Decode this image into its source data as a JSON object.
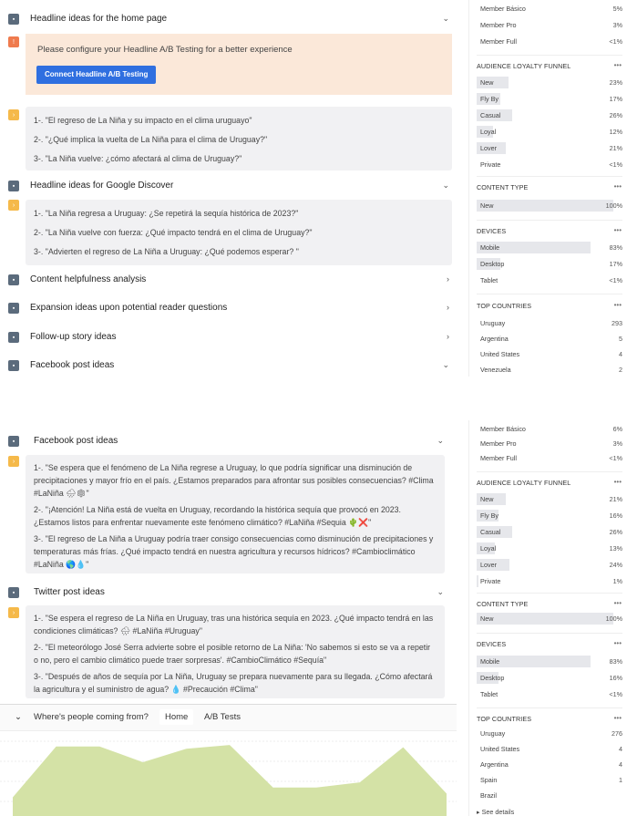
{
  "top": {
    "headline_home": {
      "title": "Headline ideas for the home page",
      "chevron": "⌄"
    },
    "warning": {
      "text": "Please configure your Headline A/B Testing for a better experience",
      "button": "Connect Headline A/B Testing"
    },
    "home_ideas": [
      "1-. \"El regreso de La Niña y su impacto en el clima uruguayo\"",
      "2-. \"¿Qué implica la vuelta de La Niña para el clima de Uruguay?\"",
      "3-. \"La Niña vuelve: ¿cómo afectará al clima de Uruguay?\""
    ],
    "discover": {
      "title": "Headline ideas for Google Discover",
      "chevron": "⌄"
    },
    "discover_ideas": [
      "1-. \"La Niña regresa a Uruguay: ¿Se repetirá la sequía histórica de 2023?\"",
      "2-. \"La Niña vuelve con fuerza: ¿Qué impacto tendrá en el clima de Uruguay?\"",
      "3-. \"Advierten el regreso de La Niña a Uruguay: ¿Qué podemos esperar? \""
    ],
    "collapsed": [
      {
        "title": "Content helpfulness analysis",
        "chevron": "›"
      },
      {
        "title": "Expansion ideas upon potential reader questions",
        "chevron": "›"
      },
      {
        "title": "Follow-up story ideas",
        "chevron": "›"
      },
      {
        "title": "Facebook post ideas",
        "chevron": "⌄"
      }
    ],
    "side": {
      "membership": [
        {
          "label": "Member Básico",
          "value": "5%"
        },
        {
          "label": "Member Pro",
          "value": "3%"
        },
        {
          "label": "Member Full",
          "value": "<1%"
        }
      ],
      "loyalty_title": "AUDIENCE LOYALTY FUNNEL",
      "loyalty": [
        {
          "label": "New",
          "value": "23%",
          "fill": 0.23
        },
        {
          "label": "Fly By",
          "value": "17%",
          "fill": 0.17
        },
        {
          "label": "Casual",
          "value": "26%",
          "fill": 0.26
        },
        {
          "label": "Loyal",
          "value": "12%",
          "fill": 0.12
        },
        {
          "label": "Lover",
          "value": "21%",
          "fill": 0.21
        },
        {
          "label": "Private",
          "value": "<1%",
          "fill": 0.0
        }
      ],
      "content_title": "CONTENT TYPE",
      "content": [
        {
          "label": "New",
          "value": "100%",
          "fill": 1.0
        }
      ],
      "devices_title": "DEVICES",
      "devices": [
        {
          "label": "Mobile",
          "value": "83%",
          "fill": 0.83
        },
        {
          "label": "Desktop",
          "value": "17%",
          "fill": 0.17
        },
        {
          "label": "Tablet",
          "value": "<1%",
          "fill": 0.0
        }
      ],
      "countries_title": "TOP COUNTRIES",
      "countries": [
        {
          "label": "Uruguay",
          "value": "293"
        },
        {
          "label": "Argentina",
          "value": "5"
        },
        {
          "label": "United States",
          "value": "4"
        },
        {
          "label": "Venezuela",
          "value": "2"
        }
      ],
      "dots": "•••"
    }
  },
  "bottom": {
    "facebook": {
      "title": "Facebook post ideas",
      "chevron": "⌄"
    },
    "facebook_ideas": [
      "1-. \"Se espera que el fenómeno de La Niña regrese a Uruguay, lo que podría significar una disminución de precipitaciones y mayor frío en el país. ¿Estamos preparados para afrontar sus posibles consecuencias? #Clima #LaNiña 🌧❄\"",
      "2-. \"¡Atención! La Niña está de vuelta en Uruguay, recordando la histórica sequía que provocó en 2023. ¿Estamos listos para enfrentar nuevamente este fenómeno climático? #LaNiña #Sequia 🌵❌\"",
      "3-. \"El regreso de La Niña a Uruguay podría traer consigo consecuencias como disminución de precipitaciones y temperaturas más frías. ¿Qué impacto tendrá en nuestra agricultura y recursos hídricos? #Cambioclimático #LaNiña 🌎💧\""
    ],
    "twitter": {
      "title": "Twitter post ideas",
      "chevron": "⌄"
    },
    "twitter_ideas": [
      "1-. \"Se espera el regreso de La Niña en Uruguay, tras una histórica sequía en 2023. ¿Qué impacto tendrá en las condiciones climáticas? 🌧 #LaNiña #Uruguay\"",
      "2-. \"El meteorólogo José Serra advierte sobre el posible retorno de La Niña: 'No sabemos si esto se va a repetir o no, pero el cambio climático puede traer sorpresas'. #CambioClimático #Sequía\"",
      "3-. \"Después de años de sequía por La Niña, Uruguay se prepara nuevamente para su llegada. ¿Cómo afectará la agricultura y el suministro de agua? 💧 #Precaución #Clima\""
    ],
    "tabs": {
      "chevron": "⌄",
      "question": "Where's people coming from?",
      "home": "Home",
      "ab": "A/B Tests"
    },
    "chart_values": [
      0.25,
      0.93,
      0.93,
      0.72,
      0.9,
      0.95,
      0.38,
      0.38,
      0.45,
      0.92,
      0.3
    ],
    "side": {
      "membership": [
        {
          "label": "Member Básico",
          "value": "6%"
        },
        {
          "label": "Member Pro",
          "value": "3%"
        },
        {
          "label": "Member Full",
          "value": "<1%"
        }
      ],
      "loyalty_title": "AUDIENCE LOYALTY FUNNEL",
      "loyalty": [
        {
          "label": "New",
          "value": "21%",
          "fill": 0.21
        },
        {
          "label": "Fly By",
          "value": "16%",
          "fill": 0.16
        },
        {
          "label": "Casual",
          "value": "26%",
          "fill": 0.26
        },
        {
          "label": "Loyal",
          "value": "13%",
          "fill": 0.13
        },
        {
          "label": "Lover",
          "value": "24%",
          "fill": 0.24
        },
        {
          "label": "Private",
          "value": "1%",
          "fill": 0.01
        }
      ],
      "content_title": "CONTENT TYPE",
      "content": [
        {
          "label": "New",
          "value": "100%",
          "fill": 1.0
        }
      ],
      "devices_title": "DEVICES",
      "devices": [
        {
          "label": "Mobile",
          "value": "83%",
          "fill": 0.83
        },
        {
          "label": "Desktop",
          "value": "16%",
          "fill": 0.16
        },
        {
          "label": "Tablet",
          "value": "<1%",
          "fill": 0.0
        }
      ],
      "countries_title": "TOP COUNTRIES",
      "countries": [
        {
          "label": "Uruguay",
          "value": "276"
        },
        {
          "label": "United States",
          "value": "4"
        },
        {
          "label": "Argentina",
          "value": "4"
        },
        {
          "label": "Spain",
          "value": "1"
        },
        {
          "label": "Brazil",
          "value": ""
        }
      ],
      "see_details": "See details",
      "dots": "•••"
    }
  },
  "colors": {
    "accent": "#2f6fe0",
    "chart_fill": "#d4e2a6",
    "warning_bg": "#fbe8d9"
  }
}
